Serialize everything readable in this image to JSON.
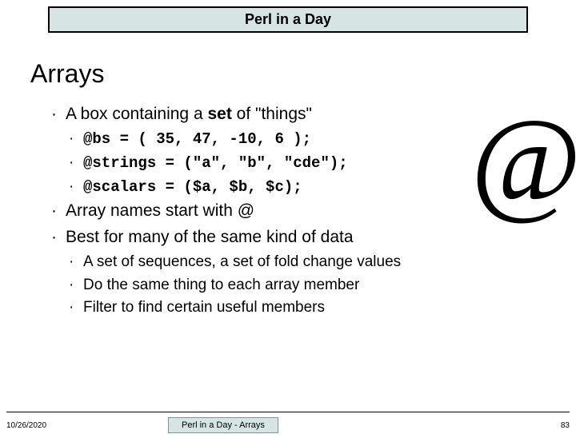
{
  "header": {
    "title": "Perl in a Day"
  },
  "slide": {
    "title": "Arrays",
    "big_symbol": "@",
    "bullets": {
      "b1": "A box containing a ",
      "b1_bold": "set",
      "b1_tail": " of \"things\"",
      "code1": "@bs = ( 35, 47, -10, 6 );",
      "code2": "@strings = (\"a\", \"b\", \"cde\");",
      "code3": "@scalars = ($a, $b, $c);",
      "b2": "Array names start with @",
      "b3": "Best for many of the same kind of data",
      "sub1": "A set of sequences, a set of fold change values",
      "sub2": "Do the same thing to each array member",
      "sub3": "Filter to find certain useful members"
    }
  },
  "footer": {
    "date": "10/26/2020",
    "center": "Perl in a Day - Arrays",
    "page": "83"
  }
}
